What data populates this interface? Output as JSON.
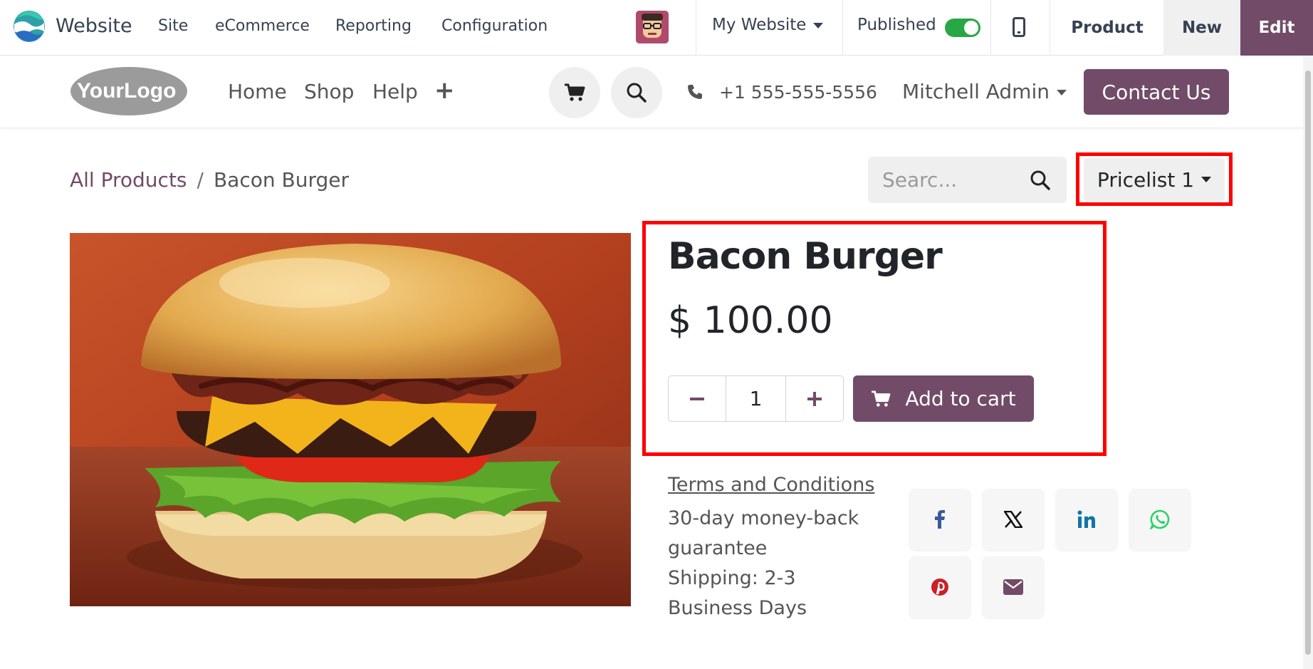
{
  "admin_bar": {
    "app_name": "Website",
    "menu": [
      "Site",
      "eCommerce",
      "Reporting",
      "Configuration"
    ],
    "website_selector": "My Website",
    "published_label": "Published",
    "published": true,
    "product_button": "Product",
    "new_button": "New",
    "edit_button": "Edit"
  },
  "navbar": {
    "logo_text": "YourLogo",
    "menu": [
      "Home",
      "Shop",
      "Help"
    ],
    "phone": "+1 555-555-5556",
    "user": "Mitchell Admin",
    "contact_button": "Contact Us"
  },
  "breadcrumb": {
    "parent": "All Products",
    "separator": "/",
    "current": "Bacon Burger"
  },
  "search": {
    "placeholder": "Searc..."
  },
  "pricelist": {
    "selected": "Pricelist 1"
  },
  "product": {
    "name": "Bacon Burger",
    "price": "$ 100.00",
    "quantity": "1",
    "add_to_cart": "Add to cart",
    "terms": "Terms and Conditions",
    "guarantee": "30-day money-back guarantee",
    "shipping": "Shipping: 2-3 Business Days"
  },
  "share_icons": [
    "facebook-icon",
    "x-icon",
    "linkedin-icon",
    "whatsapp-icon",
    "pinterest-icon",
    "email-icon"
  ],
  "colors": {
    "brand": "#714b67",
    "highlight": "#ff0000",
    "published_toggle": "#28a745"
  }
}
